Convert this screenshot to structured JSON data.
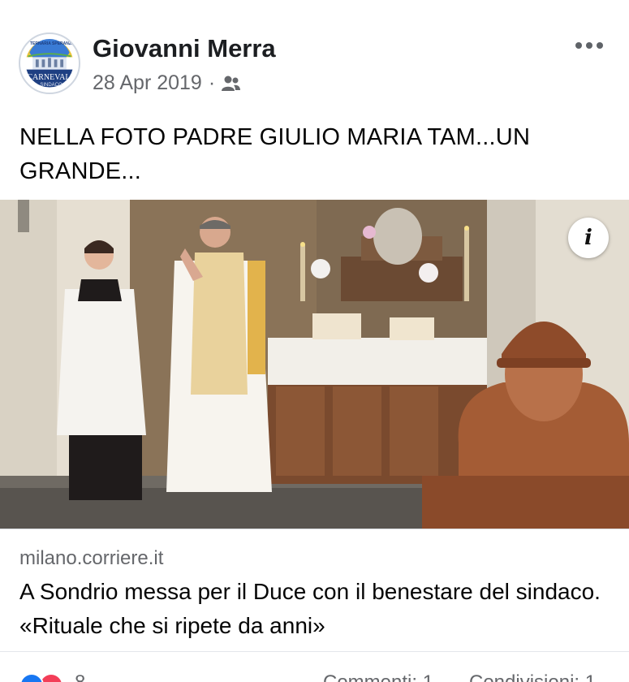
{
  "post": {
    "author": "Giovanni Merra",
    "date": "28 Apr 2019",
    "separator": "·",
    "audience_icon": "friends-icon",
    "more_icon": "more-options-icon",
    "text": "NELLA FOTO PADRE GIULIO MARIA TAM...UN GRANDE...",
    "avatar": {
      "top_text": "TERNARIA SPERANZA",
      "main_text": "CARNEVALE",
      "bottom_text": "SINDACO"
    }
  },
  "link": {
    "info_icon": "i",
    "domain": "milano.corriere.it",
    "title": "A Sondrio messa per il Duce con il benestare del sindaco. «Rituale che si ripete da anni»"
  },
  "stats": {
    "reaction_icons": [
      "like-icon",
      "love-icon"
    ],
    "reaction_count": "8",
    "comments": "Commenti: 1",
    "shares": "Condivisioni: 1"
  },
  "colors": {
    "like": "#1877f2",
    "love": "#f33e58",
    "secondary_text": "#65676b"
  }
}
